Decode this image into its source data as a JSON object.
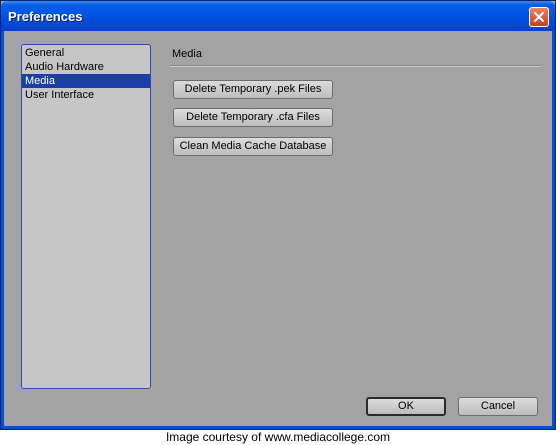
{
  "window": {
    "title": "Preferences"
  },
  "sidebar": {
    "items": [
      {
        "label": "General"
      },
      {
        "label": "Audio Hardware"
      },
      {
        "label": "Media",
        "selected": true
      },
      {
        "label": "User Interface"
      }
    ]
  },
  "panel": {
    "title": "Media",
    "buttons": [
      {
        "label": "Delete Temporary .pek Files"
      },
      {
        "label": "Delete Temporary .cfa Files"
      },
      {
        "label": "Clean Media Cache Database"
      }
    ]
  },
  "footer": {
    "ok_label": "OK",
    "cancel_label": "Cancel"
  },
  "credit": "Image courtesy of www.mediacollege.com",
  "icons": {
    "close": "close-icon"
  },
  "colors": {
    "titlebar": "#0055e5",
    "selection": "#1c3fa6",
    "dialog_bg": "#a3a3a3",
    "close_button": "#c9401d"
  }
}
